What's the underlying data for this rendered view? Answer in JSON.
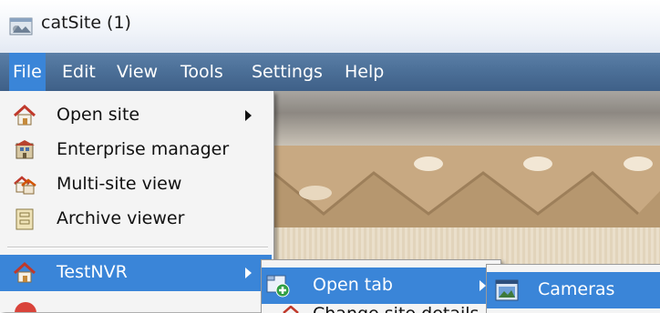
{
  "window": {
    "title": "catSite (1)",
    "icon": "app-window-icon"
  },
  "menubar": {
    "items": [
      {
        "label": "File",
        "active": true
      },
      {
        "label": "Edit"
      },
      {
        "label": "View"
      },
      {
        "label": "Tools"
      },
      {
        "label": "Settings"
      },
      {
        "label": "Help"
      }
    ]
  },
  "file_menu": {
    "items": [
      {
        "label": "Open site",
        "icon": "house-icon",
        "has_submenu": true
      },
      {
        "label": "Enterprise manager",
        "icon": "enterprise-icon"
      },
      {
        "label": "Multi-site view",
        "icon": "multi-house-icon"
      },
      {
        "label": "Archive viewer",
        "icon": "archive-icon"
      },
      {
        "label": "TestNVR",
        "icon": "house-icon",
        "has_submenu": true,
        "highlighted": true
      }
    ]
  },
  "testnvr_submenu": {
    "items": [
      {
        "label": "Open tab",
        "icon": "new-tab-icon",
        "has_submenu": true,
        "highlighted": true
      },
      {
        "label": "Change site details",
        "icon": "house-icon"
      }
    ]
  },
  "open_tab_submenu": {
    "items": [
      {
        "label": "Cameras",
        "icon": "camera-window-icon",
        "highlighted": true
      }
    ]
  },
  "colors": {
    "menubar": "#4c7098",
    "highlight": "#3a85d8",
    "menu_bg": "#f4f4f4"
  }
}
